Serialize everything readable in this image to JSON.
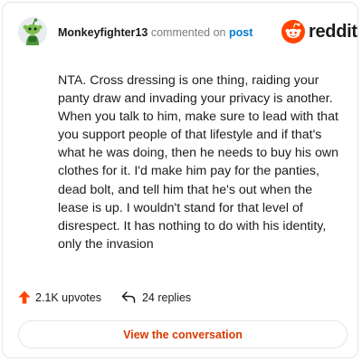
{
  "header": {
    "username": "Monkeyfighter13",
    "commented_text": "commented on",
    "post_link": "post",
    "brand": "reddit"
  },
  "comment": {
    "body": "NTA. Cross dressing is one thing, raiding your panty draw and invading your privacy is another. When you talk to him, make sure to lead with that you support people of that lifestyle and if that's what he was doing, then he needs to buy his own clothes for it. I'd make him pay for the panties, dead bolt, and tell him that he's out when the lease is up. I wouldn't stand for that level of disrespect. It has nothing to do with his identity, only the invasion"
  },
  "actions": {
    "upvotes": "2.1K upvotes",
    "replies": "24 replies"
  },
  "footer": {
    "view_label": "View the conversation"
  },
  "icons": {
    "avatar": "snoo-avatar-icon",
    "logo": "reddit-logo-icon",
    "upvote": "upvote-arrow-icon",
    "reply": "reply-arrow-icon"
  },
  "colors": {
    "upvote": "#ff4500",
    "link": "#0079d3",
    "button_text": "#d93a00",
    "brand": "#ff4500"
  }
}
